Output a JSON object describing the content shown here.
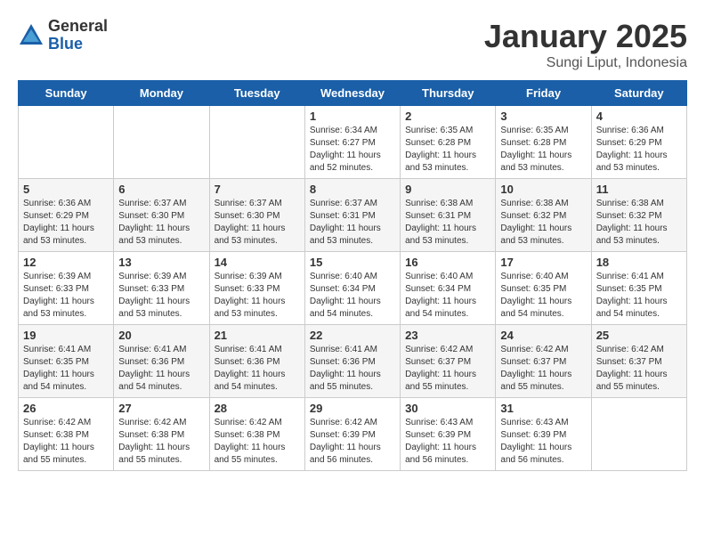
{
  "header": {
    "logo_general": "General",
    "logo_blue": "Blue",
    "month": "January 2025",
    "location": "Sungi Liput, Indonesia"
  },
  "weekdays": [
    "Sunday",
    "Monday",
    "Tuesday",
    "Wednesday",
    "Thursday",
    "Friday",
    "Saturday"
  ],
  "weeks": [
    [
      {
        "day": "",
        "sunrise": "",
        "sunset": "",
        "daylight": ""
      },
      {
        "day": "",
        "sunrise": "",
        "sunset": "",
        "daylight": ""
      },
      {
        "day": "",
        "sunrise": "",
        "sunset": "",
        "daylight": ""
      },
      {
        "day": "1",
        "sunrise": "Sunrise: 6:34 AM",
        "sunset": "Sunset: 6:27 PM",
        "daylight": "Daylight: 11 hours and 52 minutes."
      },
      {
        "day": "2",
        "sunrise": "Sunrise: 6:35 AM",
        "sunset": "Sunset: 6:28 PM",
        "daylight": "Daylight: 11 hours and 53 minutes."
      },
      {
        "day": "3",
        "sunrise": "Sunrise: 6:35 AM",
        "sunset": "Sunset: 6:28 PM",
        "daylight": "Daylight: 11 hours and 53 minutes."
      },
      {
        "day": "4",
        "sunrise": "Sunrise: 6:36 AM",
        "sunset": "Sunset: 6:29 PM",
        "daylight": "Daylight: 11 hours and 53 minutes."
      }
    ],
    [
      {
        "day": "5",
        "sunrise": "Sunrise: 6:36 AM",
        "sunset": "Sunset: 6:29 PM",
        "daylight": "Daylight: 11 hours and 53 minutes."
      },
      {
        "day": "6",
        "sunrise": "Sunrise: 6:37 AM",
        "sunset": "Sunset: 6:30 PM",
        "daylight": "Daylight: 11 hours and 53 minutes."
      },
      {
        "day": "7",
        "sunrise": "Sunrise: 6:37 AM",
        "sunset": "Sunset: 6:30 PM",
        "daylight": "Daylight: 11 hours and 53 minutes."
      },
      {
        "day": "8",
        "sunrise": "Sunrise: 6:37 AM",
        "sunset": "Sunset: 6:31 PM",
        "daylight": "Daylight: 11 hours and 53 minutes."
      },
      {
        "day": "9",
        "sunrise": "Sunrise: 6:38 AM",
        "sunset": "Sunset: 6:31 PM",
        "daylight": "Daylight: 11 hours and 53 minutes."
      },
      {
        "day": "10",
        "sunrise": "Sunrise: 6:38 AM",
        "sunset": "Sunset: 6:32 PM",
        "daylight": "Daylight: 11 hours and 53 minutes."
      },
      {
        "day": "11",
        "sunrise": "Sunrise: 6:38 AM",
        "sunset": "Sunset: 6:32 PM",
        "daylight": "Daylight: 11 hours and 53 minutes."
      }
    ],
    [
      {
        "day": "12",
        "sunrise": "Sunrise: 6:39 AM",
        "sunset": "Sunset: 6:33 PM",
        "daylight": "Daylight: 11 hours and 53 minutes."
      },
      {
        "day": "13",
        "sunrise": "Sunrise: 6:39 AM",
        "sunset": "Sunset: 6:33 PM",
        "daylight": "Daylight: 11 hours and 53 minutes."
      },
      {
        "day": "14",
        "sunrise": "Sunrise: 6:39 AM",
        "sunset": "Sunset: 6:33 PM",
        "daylight": "Daylight: 11 hours and 53 minutes."
      },
      {
        "day": "15",
        "sunrise": "Sunrise: 6:40 AM",
        "sunset": "Sunset: 6:34 PM",
        "daylight": "Daylight: 11 hours and 54 minutes."
      },
      {
        "day": "16",
        "sunrise": "Sunrise: 6:40 AM",
        "sunset": "Sunset: 6:34 PM",
        "daylight": "Daylight: 11 hours and 54 minutes."
      },
      {
        "day": "17",
        "sunrise": "Sunrise: 6:40 AM",
        "sunset": "Sunset: 6:35 PM",
        "daylight": "Daylight: 11 hours and 54 minutes."
      },
      {
        "day": "18",
        "sunrise": "Sunrise: 6:41 AM",
        "sunset": "Sunset: 6:35 PM",
        "daylight": "Daylight: 11 hours and 54 minutes."
      }
    ],
    [
      {
        "day": "19",
        "sunrise": "Sunrise: 6:41 AM",
        "sunset": "Sunset: 6:35 PM",
        "daylight": "Daylight: 11 hours and 54 minutes."
      },
      {
        "day": "20",
        "sunrise": "Sunrise: 6:41 AM",
        "sunset": "Sunset: 6:36 PM",
        "daylight": "Daylight: 11 hours and 54 minutes."
      },
      {
        "day": "21",
        "sunrise": "Sunrise: 6:41 AM",
        "sunset": "Sunset: 6:36 PM",
        "daylight": "Daylight: 11 hours and 54 minutes."
      },
      {
        "day": "22",
        "sunrise": "Sunrise: 6:41 AM",
        "sunset": "Sunset: 6:36 PM",
        "daylight": "Daylight: 11 hours and 55 minutes."
      },
      {
        "day": "23",
        "sunrise": "Sunrise: 6:42 AM",
        "sunset": "Sunset: 6:37 PM",
        "daylight": "Daylight: 11 hours and 55 minutes."
      },
      {
        "day": "24",
        "sunrise": "Sunrise: 6:42 AM",
        "sunset": "Sunset: 6:37 PM",
        "daylight": "Daylight: 11 hours and 55 minutes."
      },
      {
        "day": "25",
        "sunrise": "Sunrise: 6:42 AM",
        "sunset": "Sunset: 6:37 PM",
        "daylight": "Daylight: 11 hours and 55 minutes."
      }
    ],
    [
      {
        "day": "26",
        "sunrise": "Sunrise: 6:42 AM",
        "sunset": "Sunset: 6:38 PM",
        "daylight": "Daylight: 11 hours and 55 minutes."
      },
      {
        "day": "27",
        "sunrise": "Sunrise: 6:42 AM",
        "sunset": "Sunset: 6:38 PM",
        "daylight": "Daylight: 11 hours and 55 minutes."
      },
      {
        "day": "28",
        "sunrise": "Sunrise: 6:42 AM",
        "sunset": "Sunset: 6:38 PM",
        "daylight": "Daylight: 11 hours and 55 minutes."
      },
      {
        "day": "29",
        "sunrise": "Sunrise: 6:42 AM",
        "sunset": "Sunset: 6:39 PM",
        "daylight": "Daylight: 11 hours and 56 minutes."
      },
      {
        "day": "30",
        "sunrise": "Sunrise: 6:43 AM",
        "sunset": "Sunset: 6:39 PM",
        "daylight": "Daylight: 11 hours and 56 minutes."
      },
      {
        "day": "31",
        "sunrise": "Sunrise: 6:43 AM",
        "sunset": "Sunset: 6:39 PM",
        "daylight": "Daylight: 11 hours and 56 minutes."
      },
      {
        "day": "",
        "sunrise": "",
        "sunset": "",
        "daylight": ""
      }
    ]
  ]
}
